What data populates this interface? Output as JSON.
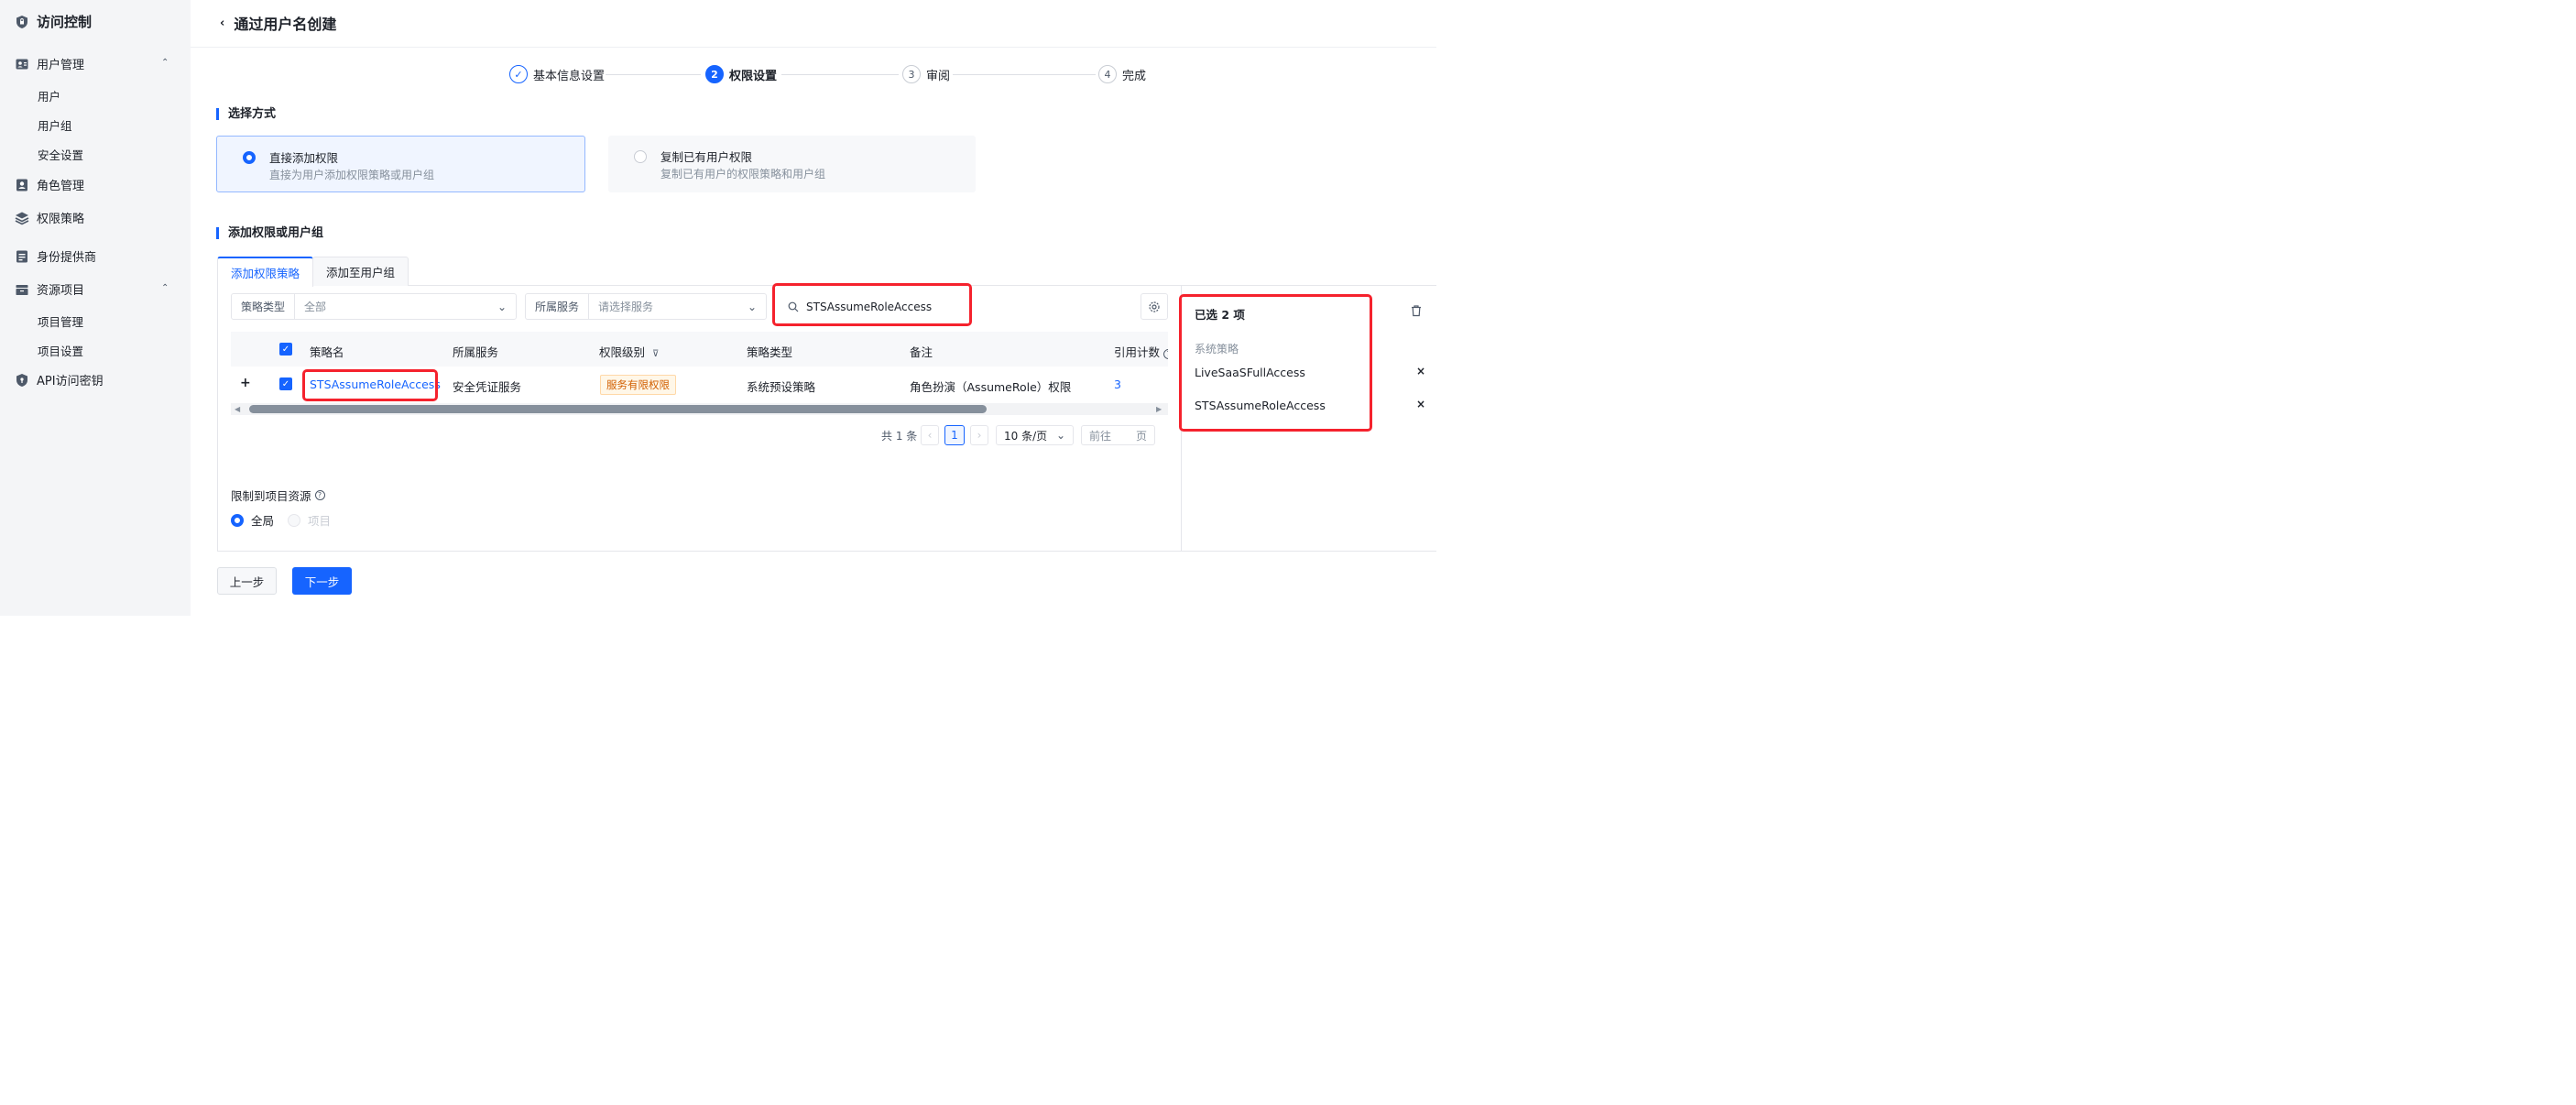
{
  "sidebar": {
    "brand": "访问控制",
    "user_mgmt": "用户管理",
    "users": "用户",
    "user_groups": "用户组",
    "security": "安全设置",
    "roles": "角色管理",
    "policies": "权限策略",
    "idp": "身份提供商",
    "resources": "资源项目",
    "project_mgmt": "项目管理",
    "project_settings": "项目设置",
    "api_keys": "API访问密钥"
  },
  "header": {
    "title": "通过用户名创建"
  },
  "steps": [
    {
      "num": "✓",
      "label": "基本信息设置"
    },
    {
      "num": "2",
      "label": "权限设置"
    },
    {
      "num": "3",
      "label": "审阅"
    },
    {
      "num": "4",
      "label": "完成"
    }
  ],
  "method": {
    "section_title": "选择方式",
    "option1_title": "直接添加权限",
    "option1_desc": "直接为用户添加权限策略或用户组",
    "option2_title": "复制已有用户权限",
    "option2_desc": "复制已有用户的权限策略和用户组"
  },
  "perm": {
    "section_title": "添加权限或用户组",
    "tab1": "添加权限策略",
    "tab2": "添加至用户组"
  },
  "filters": {
    "policy_type_label": "策略类型",
    "policy_type_value": "全部",
    "service_label": "所属服务",
    "service_placeholder": "请选择服务",
    "search_value": "STSAssumeRoleAccess"
  },
  "table": {
    "headers": [
      "策略名",
      "所属服务",
      "权限级别",
      "策略类型",
      "备注",
      "引用计数"
    ],
    "row": {
      "name": "STSAssumeRoleAccess",
      "service": "安全凭证服务",
      "level": "服务有限权限",
      "type": "系统预设策略",
      "note": "角色扮演（AssumeRole）权限",
      "count": "3"
    }
  },
  "pagination": {
    "total": "共 1 条",
    "page": "1",
    "page_size": "10 条/页",
    "goto_prefix": "前往",
    "goto_suffix": "页"
  },
  "restrict": {
    "label": "限制到项目资源",
    "global": "全局",
    "project": "项目"
  },
  "selected": {
    "title": "已选 2 项",
    "group": "系统策略",
    "items": [
      "LiveSaaSFullAccess",
      "STSAssumeRoleAccess"
    ],
    "remove_symbol": "×"
  },
  "footer": {
    "prev": "上一步",
    "next": "下一步"
  },
  "colors": {
    "primary": "#1664ff",
    "highlight": "#f5222d",
    "tag_bg": "#fff7e8",
    "tag_text": "#d25f00"
  }
}
